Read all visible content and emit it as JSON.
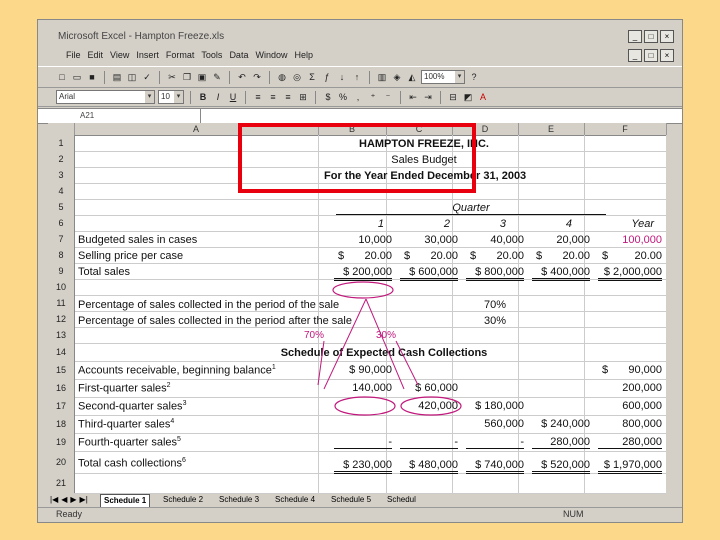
{
  "window": {
    "title": "Microsoft Excel - Hampton Freeze.xls",
    "min": "_",
    "max": "□",
    "close": "×"
  },
  "menu": [
    "File",
    "Edit",
    "View",
    "Insert",
    "Format",
    "Tools",
    "Data",
    "Window",
    "Help"
  ],
  "toolbar": {
    "zoom": "100%",
    "font": "Arial",
    "size": "10"
  },
  "namebox": "A21",
  "columns": [
    "A",
    "B",
    "C",
    "D",
    "E",
    "F"
  ],
  "rows": [
    "1",
    "2",
    "3",
    "4",
    "5",
    "6",
    "7",
    "8",
    "9",
    "10",
    "11",
    "12",
    "13",
    "14",
    "15",
    "16",
    "17",
    "18",
    "19",
    "20",
    "21"
  ],
  "header": {
    "company": "HAMPTON FREEZE, INC.",
    "report": "Sales Budget",
    "period": "For the Year Ended December 31, 2003"
  },
  "quarter_label": "Quarter",
  "col_heads": [
    "1",
    "2",
    "3",
    "4",
    "Year"
  ],
  "budget": {
    "units": {
      "label": "Budgeted sales in cases",
      "values": [
        "10,000",
        "30,000",
        "40,000",
        "20,000",
        "100,000"
      ]
    },
    "price": {
      "label": "Selling price per case",
      "values": [
        "$",
        "20.00",
        "$",
        "20.00",
        "$",
        "20.00",
        "$",
        "20.00",
        "$",
        "20.00"
      ]
    },
    "total": {
      "label": "Total sales",
      "values": [
        "$ 200,000",
        "$ 600,000",
        "$ 800,000",
        "$ 400,000",
        "$  2,000,000"
      ]
    }
  },
  "collection": {
    "row11": {
      "label": "Percentage of sales collected in the period of the sale",
      "value": "70%"
    },
    "row12": {
      "label": "Percentage of sales collected in the period after the sale",
      "value": "30%"
    },
    "annot70": "70%",
    "annot30": "30%"
  },
  "schedule": {
    "title": "Schedule of Expected Cash Collections",
    "ar": {
      "label": "Accounts receivable, beginning balance",
      "note": "1",
      "q1": "$   90,000",
      "year_sign": "$",
      "year": "90,000"
    },
    "first": {
      "label": "First-quarter sales",
      "note": "2",
      "q1": "140,000",
      "q2": "$   60,000",
      "year": "200,000"
    },
    "second": {
      "label": "Second-quarter sales",
      "note": "3",
      "q2": "420,000",
      "q3": "$  180,000",
      "year": "600,000"
    },
    "third": {
      "label": "Third-quarter sales",
      "note": "4",
      "q3": "560,000",
      "q4": "$  240,000",
      "year": "800,000"
    },
    "fourth": {
      "label": "Fourth-quarter sales",
      "note": "5",
      "q1": "-",
      "q2": "-",
      "q3": "-",
      "q4": "280,000",
      "year": "280,000"
    },
    "total": {
      "label": "Total cash collections",
      "note": "6",
      "values": [
        "$ 230,000",
        "$ 480,000",
        "$ 740,000",
        "$ 520,000",
        "$  1,970,000"
      ]
    }
  },
  "sheets": [
    "Schedule 1",
    "Schedule 2",
    "Schedule 3",
    "Schedule 4",
    "Schedule 5",
    "Schedul"
  ],
  "status": {
    "text": "Ready",
    "num": "NUM"
  },
  "colors": {
    "accent_box": "#e8000f",
    "annotation": "#c2187c",
    "background": "#fcd88a"
  }
}
